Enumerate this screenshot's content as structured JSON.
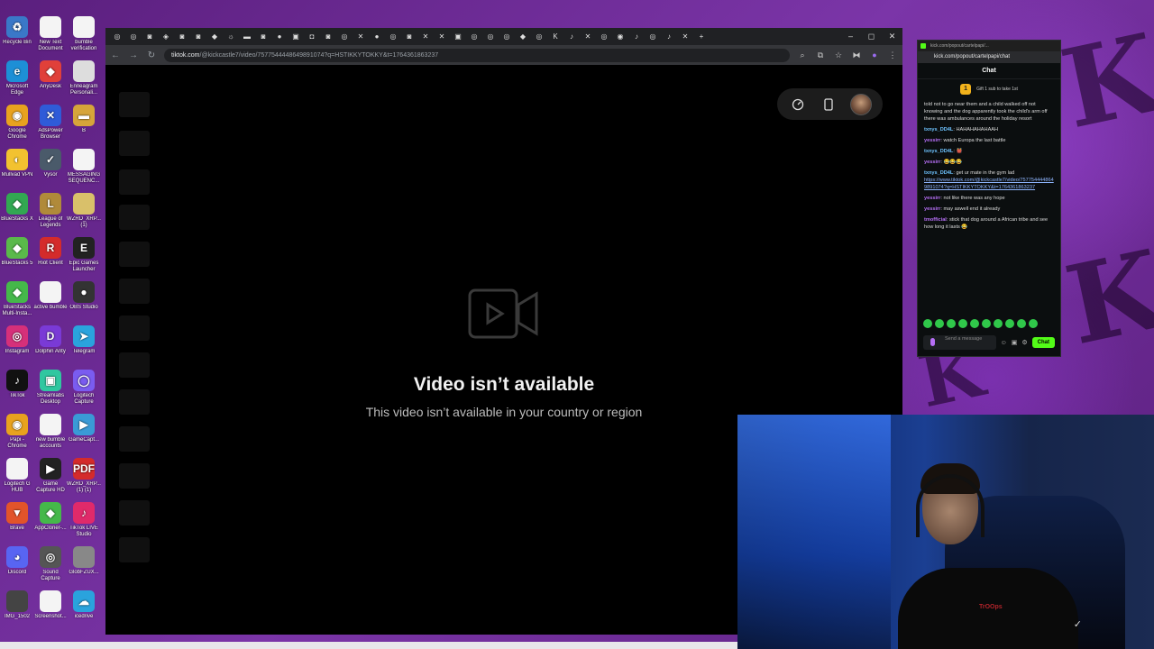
{
  "desktop": {
    "icons": [
      {
        "label": "Recycle Bin",
        "glyph": "♻",
        "color": "#3a78c8"
      },
      {
        "label": "New Text Document",
        "glyph": "",
        "color": "#f4f4f4"
      },
      {
        "label": "bumble verification",
        "glyph": "",
        "color": "#f4f4f4"
      },
      {
        "label": "Microsoft Edge",
        "glyph": "e",
        "color": "#1d8fd6"
      },
      {
        "label": "AnyDesk",
        "glyph": "◆",
        "color": "#e0403a"
      },
      {
        "label": "Enneagram Personali...",
        "glyph": "",
        "color": "#ddd"
      },
      {
        "label": "Google Chrome",
        "glyph": "◉",
        "color": "#e8a21e"
      },
      {
        "label": "AdsPower Browser",
        "glyph": "✕",
        "color": "#2f5bd8"
      },
      {
        "label": "B",
        "glyph": "▬",
        "color": "#d6a53a"
      },
      {
        "label": "Mullvad VPN",
        "glyph": "◐",
        "color": "#f2c230"
      },
      {
        "label": "Vysor",
        "glyph": "✓",
        "color": "#4a5a6a"
      },
      {
        "label": "MESSAGING SEQUENC...",
        "glyph": "",
        "color": "#f4f4f4"
      },
      {
        "label": "BlueStacks X",
        "glyph": "◆",
        "color": "#32a852"
      },
      {
        "label": "League of Legends",
        "glyph": "L",
        "color": "#b08a3a"
      },
      {
        "label": "WZRD_XRP... (1)",
        "glyph": "",
        "color": "#d9c06a"
      },
      {
        "label": "BlueStacks 5",
        "glyph": "◆",
        "color": "#5ab94a"
      },
      {
        "label": "Riot Client",
        "glyph": "R",
        "color": "#d42b2b"
      },
      {
        "label": "Epic Games Launcher",
        "glyph": "E",
        "color": "#222"
      },
      {
        "label": "BlueStacks Multi-Insta...",
        "glyph": "◆",
        "color": "#45b84a"
      },
      {
        "label": "active bumble",
        "glyph": "",
        "color": "#f4f4f4"
      },
      {
        "label": "OBS Studio",
        "glyph": "●",
        "color": "#333"
      },
      {
        "label": "Instagram",
        "glyph": "◎",
        "color": "#d6307a"
      },
      {
        "label": "Dolphin Anty",
        "glyph": "D",
        "color": "#7a3ad6"
      },
      {
        "label": "Telegram",
        "glyph": "➤",
        "color": "#2aa3dd"
      },
      {
        "label": "TikTok",
        "glyph": "♪",
        "color": "#111"
      },
      {
        "label": "Streamlabs Desktop",
        "glyph": "▣",
        "color": "#30c7a0"
      },
      {
        "label": "Logitech Capture",
        "glyph": "◯",
        "color": "#7a5cf0"
      },
      {
        "label": "Papi - Chrome",
        "glyph": "◉",
        "color": "#e8a21e"
      },
      {
        "label": "new bumble accounts",
        "glyph": "",
        "color": "#f4f4f4"
      },
      {
        "label": "GameCapt...",
        "glyph": "▶",
        "color": "#3a9ad6"
      },
      {
        "label": "Logitech G HUB",
        "glyph": "",
        "color": "#f4f4f4"
      },
      {
        "label": "Game Capture HD",
        "glyph": "▶",
        "color": "#222"
      },
      {
        "label": "WZRD_XRP... (1) (1)",
        "glyph": "PDF",
        "color": "#d42b2b"
      },
      {
        "label": "Brave",
        "glyph": "▼",
        "color": "#e2542a"
      },
      {
        "label": "AppCloner-...",
        "glyph": "◆",
        "color": "#45b84a"
      },
      {
        "label": "TikTok LIVE Studio",
        "glyph": "♪",
        "color": "#e02a6a"
      },
      {
        "label": "Discord",
        "glyph": "◕",
        "color": "#5865f2"
      },
      {
        "label": "Sound Capture",
        "glyph": "◎",
        "color": "#555"
      },
      {
        "label": "GlobFZUX...",
        "glyph": "",
        "color": "#888"
      },
      {
        "label": "IMG_1502",
        "glyph": "",
        "color": "#444"
      },
      {
        "label": "Screenshot...",
        "glyph": "",
        "color": "#f4f4f4"
      },
      {
        "label": "icedrive",
        "glyph": "☁",
        "color": "#2aa3dd"
      }
    ]
  },
  "browser": {
    "tab_favicons": [
      "◎",
      "◎",
      "◙",
      "◈",
      "◙",
      "◙",
      "◆",
      "☼",
      "▬",
      "◙",
      "●",
      "▣",
      "◘",
      "◙",
      "◎",
      "✕",
      "●",
      "◎",
      "◙",
      "✕",
      "✕",
      "▣",
      "◎",
      "◎",
      "◎",
      "◆",
      "◎",
      "K",
      "♪",
      "✕",
      "◎",
      "◉",
      "♪",
      "◎",
      "♪",
      "✕"
    ],
    "new_tab": "+",
    "window_controls": [
      "–",
      "◻",
      "✕"
    ],
    "url_host": "tiktok.com",
    "url_path": "/@kickcastle7/video/7577544448649891074?q=HSTIKKYTOKKY&t=1764361863237",
    "reload_icon": "↻",
    "back_icon": "←",
    "forward_icon": "→"
  },
  "video": {
    "title": "Video isn’t available",
    "subtitle": "This video isn’t available in your country or region"
  },
  "chat": {
    "title_bar": "kick.com/popout/cartelpapi/...",
    "url": "kick.com/popout/cartelpapi/chat",
    "header": "Chat",
    "gift_text": "Gift 1 sub to take 1st",
    "gift_badge": "1",
    "messages": [
      {
        "user": "",
        "text": "told not to go near them and a child walked off not knowing and the dog apparently took the child's arm off there was ambulances around the holiday resort",
        "color": "#ddd"
      },
      {
        "user": "txnys_DD4L",
        "text": ": HAHAHAHAHAAH",
        "color": "#6ec3ff"
      },
      {
        "user": "yessirr",
        "text": ": watch Europa the last battle",
        "color": "#b66ff5"
      },
      {
        "user": "txnys_DD4L",
        "text": ": 👹",
        "color": "#6ec3ff"
      },
      {
        "user": "yessirr",
        "text": ": 😂😂😂",
        "color": "#b66ff5"
      },
      {
        "user": "txnys_DD4L",
        "text": ": get ur mate in the gym lad",
        "color": "#6ec3ff",
        "link": "https://www.tiktok.com/@kickcastle7/video/7577544448649891074?q=HSTIKKYTOKKY&t=1764361863237"
      },
      {
        "user": "yessirr",
        "text": ": not like there was any hope",
        "color": "#b66ff5"
      },
      {
        "user": "yessirr",
        "text": ": may aswell end it already",
        "color": "#b66ff5"
      },
      {
        "user": "tmofficial",
        "text": ": stick that dog around a African tribe and see how long it lasts 😂",
        "color": "#b66ff5"
      }
    ],
    "input_placeholder": "Send a message",
    "send_label": "Chat"
  },
  "webcam": {
    "shirt_logo": "TrOOps"
  }
}
